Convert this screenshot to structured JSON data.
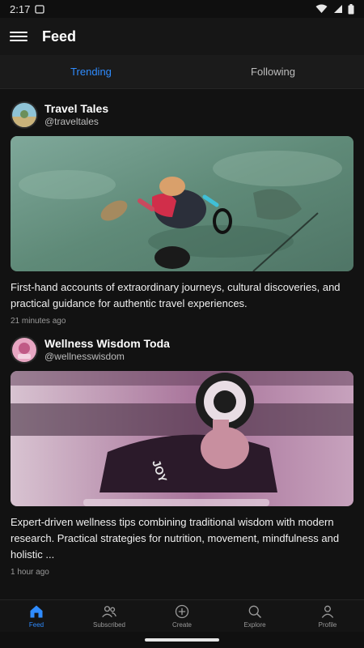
{
  "status_bar": {
    "time": "2:17"
  },
  "app_bar": {
    "title": "Feed"
  },
  "tabs": [
    {
      "label": "Trending",
      "active": true
    },
    {
      "label": "Following",
      "active": false
    }
  ],
  "posts": [
    {
      "author_name": "Travel Tales",
      "handle": "@traveltales",
      "text": "First-hand accounts of extraordinary journeys, cultural discoveries, and practical guidance for authentic travel experiences.",
      "time": "21 minutes ago"
    },
    {
      "author_name": "Wellness Wisdom Toda",
      "handle": "@wellnesswisdom",
      "text": "Expert-driven wellness tips combining traditional wisdom with modern research. Practical strategies for nutrition, movement, mindfulness and holistic ...",
      "time": "1 hour ago"
    }
  ],
  "bottom_nav": [
    {
      "label": "Feed",
      "icon": "home-icon",
      "active": true
    },
    {
      "label": "Subscribed",
      "icon": "people-icon",
      "active": false
    },
    {
      "label": "Create",
      "icon": "plus-circle-icon",
      "active": false
    },
    {
      "label": "Explore",
      "icon": "search-icon",
      "active": false
    },
    {
      "label": "Profile",
      "icon": "person-icon",
      "active": false
    }
  ],
  "colors": {
    "accent": "#2f8cff",
    "background": "#121212"
  }
}
